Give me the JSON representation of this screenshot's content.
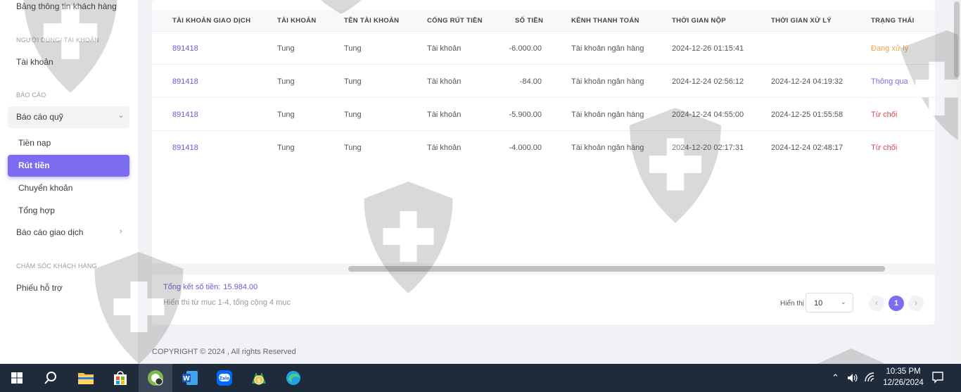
{
  "sidebar": {
    "items": {
      "customer_info": "Bảng thông tin khách hàng",
      "section_users": "NGƯỜI DÙNG/ TÀI KHOẢN",
      "accounts": "Tài khoản",
      "section_reports": "BÁO CÁO",
      "fund_report": "Báo cáo quỹ",
      "deposit": "Tiền nạp",
      "withdraw": "Rút tiền",
      "transfer": "Chuyển khoản",
      "summary": "Tổng hợp",
      "trade_report": "Báo cáo giao dịch",
      "section_support": "CHĂM SÓC KHÁCH HÀNG",
      "tickets": "Phiếu hỗ trợ"
    }
  },
  "table": {
    "headers": {
      "trading_account": "TÀI KHOẢN GIAO DỊCH",
      "account": "TÀI KHOẢN",
      "account_name": "TÊN TÀI KHOẢN",
      "gateway": "CỔNG RÚT TIỀN",
      "amount": "SỐ TIỀN",
      "channel": "KÊNH THANH TOÁN",
      "submitted": "THỜI GIAN NỘP",
      "processed": "THỜI GIAN XỬ LÝ",
      "status": "TRẠNG THÁI"
    },
    "rows": [
      {
        "trading_account": "891418",
        "account": "Tung",
        "account_name": "Tung",
        "gateway": "Tài khoản",
        "amount": "-6.000.00",
        "channel": "Tài khoản ngân hàng",
        "submitted": "2024-12-26 01:15:41",
        "processed": "",
        "status": "Đang xử lý"
      },
      {
        "trading_account": "891418",
        "account": "Tung",
        "account_name": "Tung",
        "gateway": "Tài khoản",
        "amount": "-84.00",
        "channel": "Tài khoản ngân hàng",
        "submitted": "2024-12-24 02:56:12",
        "processed": "2024-12-24 04:19:32",
        "status": "Thông qua"
      },
      {
        "trading_account": "891418",
        "account": "Tung",
        "account_name": "Tung",
        "gateway": "Tài khoản",
        "amount": "-5.900.00",
        "channel": "Tài khoản ngân hàng",
        "submitted": "2024-12-24 04:55:00",
        "processed": "2024-12-25 01:55:58",
        "status": "Từ chối"
      },
      {
        "trading_account": "891418",
        "account": "Tung",
        "account_name": "Tung",
        "gateway": "Tài khoản",
        "amount": "-4.000.00",
        "channel": "Tài khoản ngân hàng",
        "submitted": "2024-12-20 02:17:31",
        "processed": "2024-12-24 02:48:17",
        "status": "Từ chối"
      }
    ]
  },
  "footer": {
    "total_label": "Tổng kết số tiền:",
    "total_value": "15.984.00",
    "showing": "Hiển thị từ mục 1-4, tổng cộng 4 mục",
    "per_page_label": "Hiển thị",
    "per_page_value": "10",
    "current_page": "1",
    "copyright": "COPYRIGHT © 2024 , All rights Reserved"
  },
  "taskbar": {
    "time": "10:35 PM",
    "date": "12/26/2024",
    "apps": [
      "windows-start",
      "search",
      "file-explorer",
      "microsoft-store",
      "browser-app",
      "microsoft-word",
      "zalo",
      "metatrader",
      "microsoft-edge"
    ]
  },
  "colors": {
    "accent": "#7b6cf0",
    "pending": "#f0a24a",
    "approved": "#7b6cf0",
    "rejected": "#e0435a",
    "taskbar": "#1f2b3a"
  }
}
